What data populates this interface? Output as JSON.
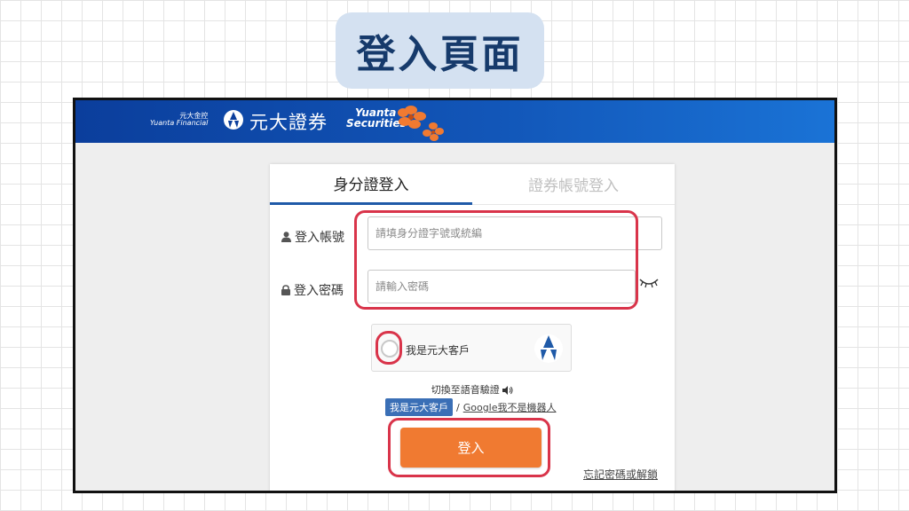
{
  "page_title": "登入頁面",
  "header": {
    "brand_small_cn": "元大金控",
    "brand_small_en": "Yuanta Financial",
    "brand_name": "元大證券",
    "brand_en_line1": "Yuanta",
    "brand_en_line2": "Securities",
    "logo_icon": "yuanta-logo-icon"
  },
  "tabs": [
    {
      "label": "身分證登入",
      "active": true
    },
    {
      "label": "證券帳號登入",
      "active": false
    }
  ],
  "form": {
    "account_label": "登入帳號",
    "account_icon": "user-icon",
    "account_placeholder": "請填身分證字號或統編",
    "password_label": "登入密碼",
    "password_icon": "lock-icon",
    "password_placeholder": "請輸入密碼",
    "toggle_icon": "eye-closed-icon"
  },
  "captcha": {
    "label": "我是元大客戶",
    "voice_switch": "切換至語音驗證",
    "voice_icon": "speaker-icon",
    "verify_active": "我是元大客戶",
    "verify_separator": "/",
    "verify_alt": "Google我不是機器人"
  },
  "login_button": "登入",
  "forgot_link": "忘記密碼或解鎖",
  "colors": {
    "header_blue": "#0b3e9c",
    "accent_orange": "#f07a31",
    "highlight_red": "#d9344a",
    "tab_underline": "#1f5aa8"
  }
}
